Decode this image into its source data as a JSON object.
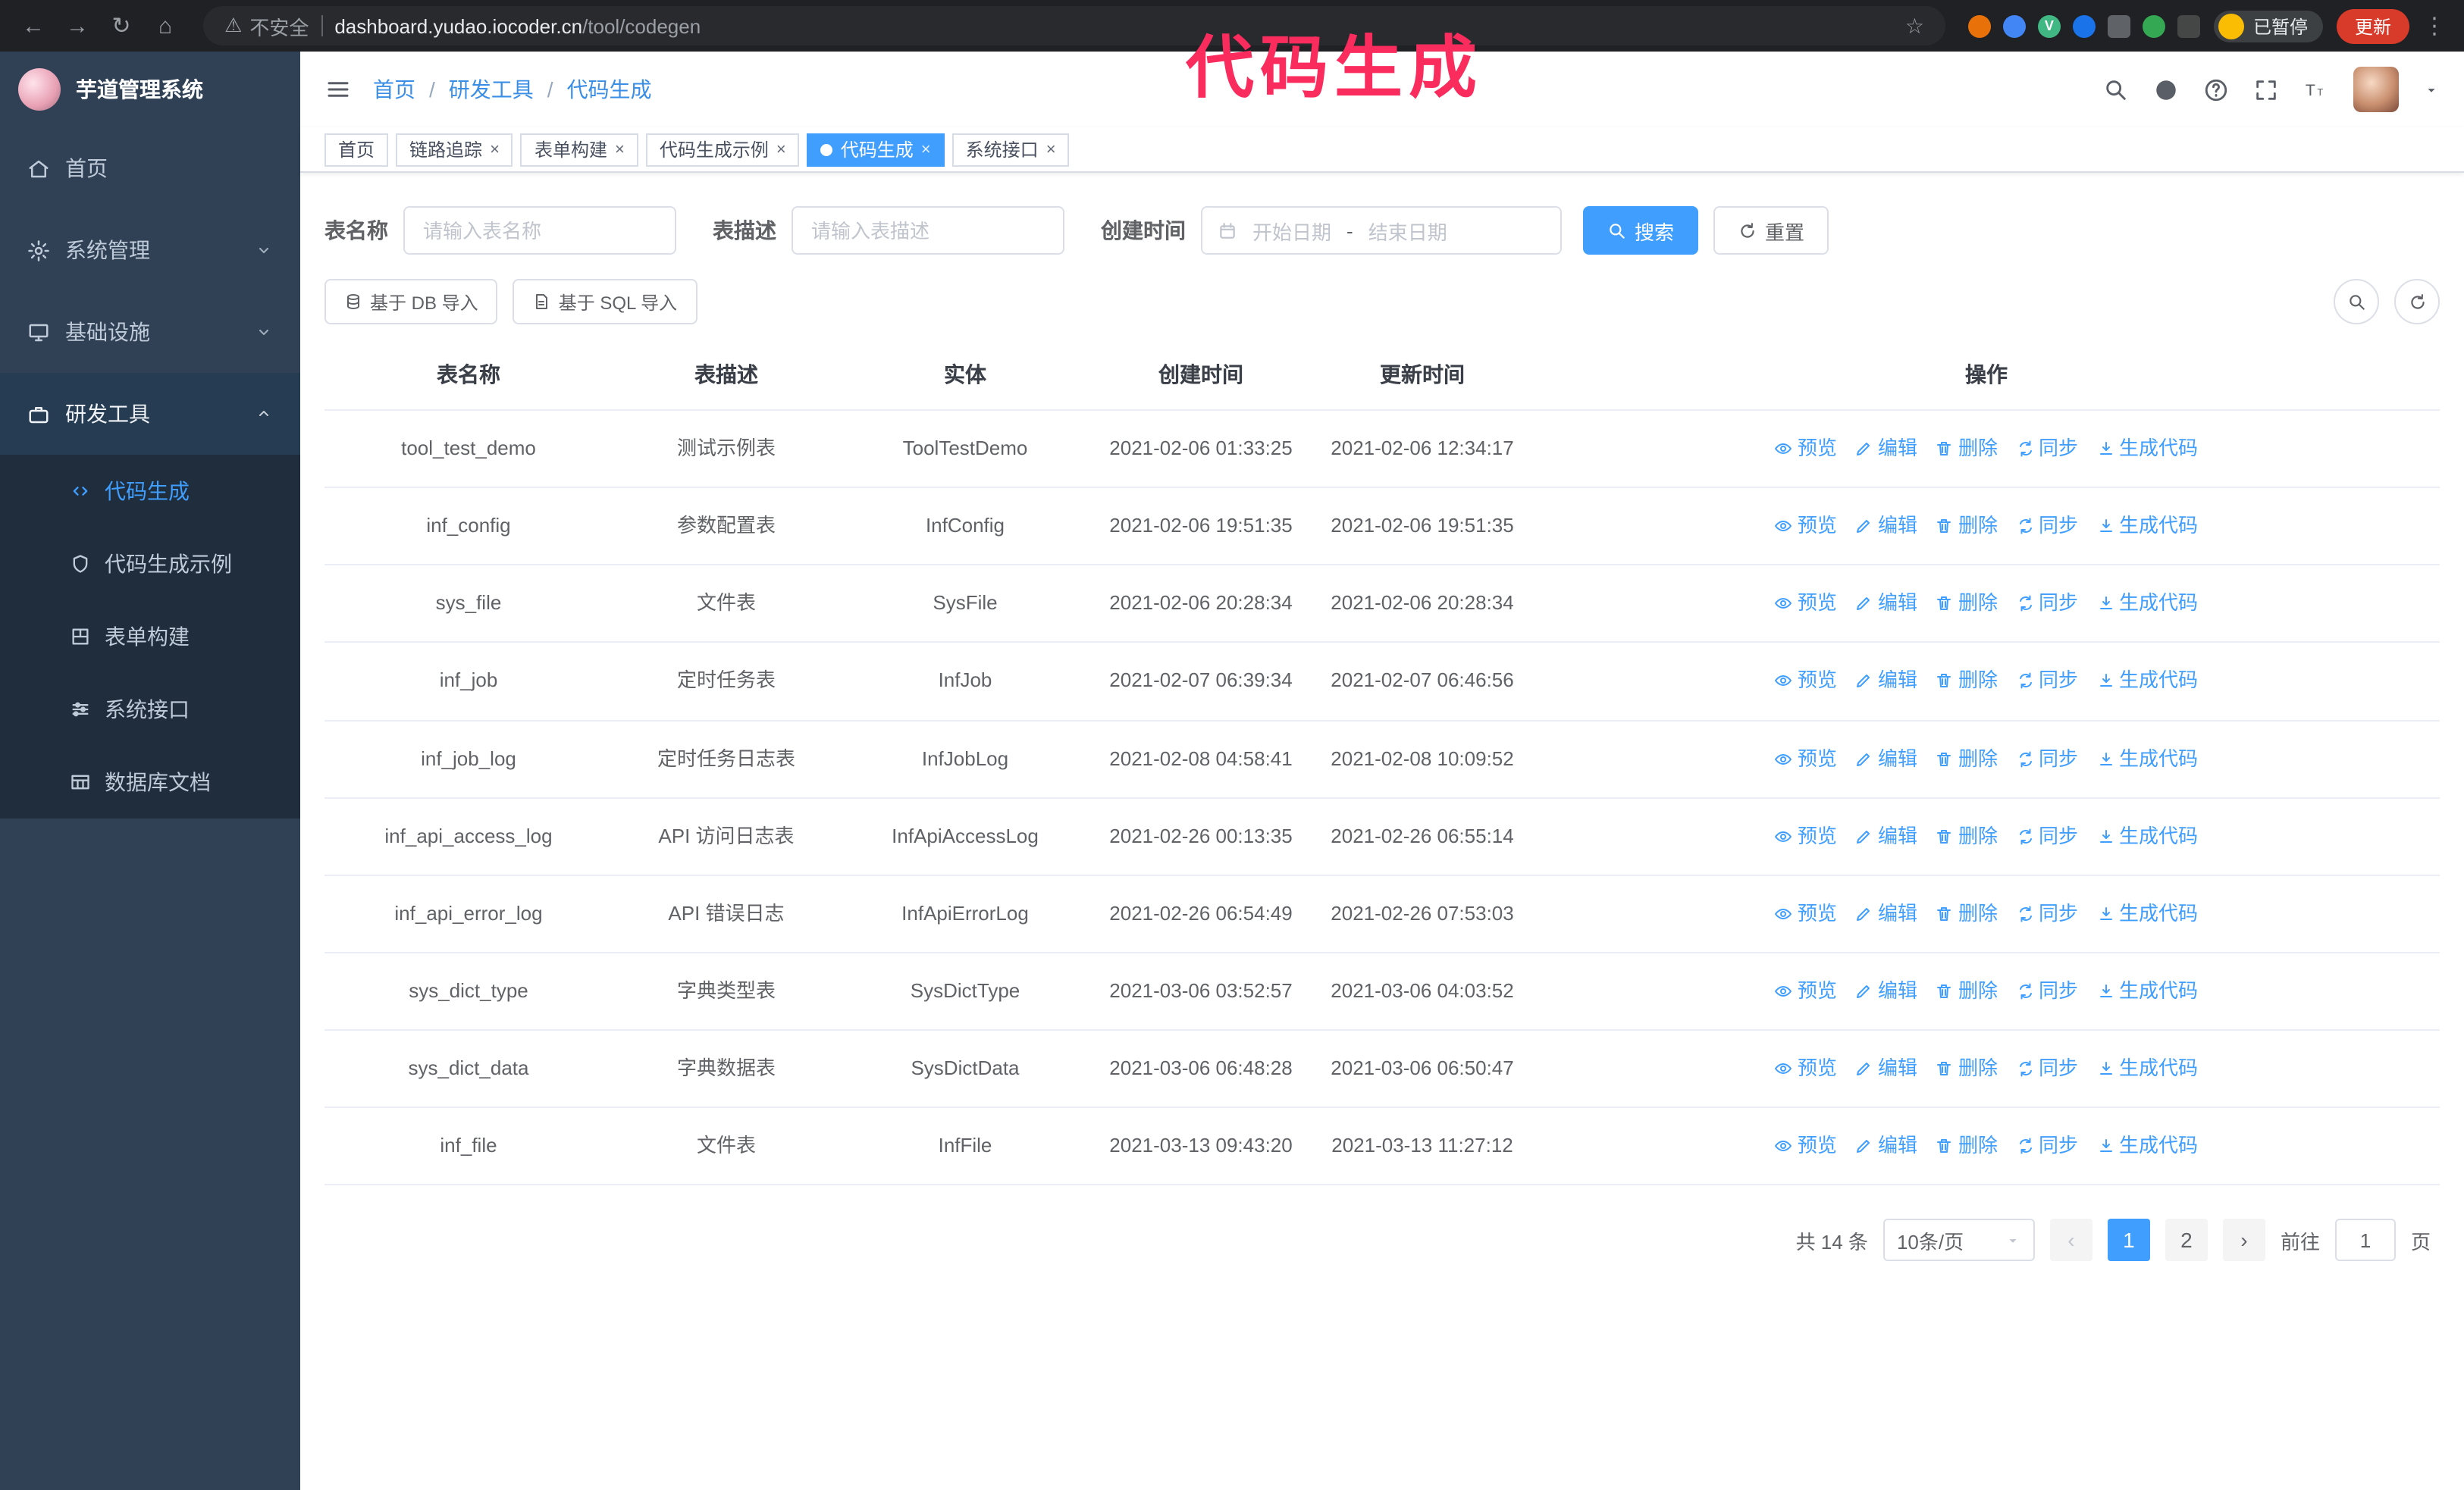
{
  "colors": {
    "accent": "#409eff",
    "sidebar_bg": "#304156",
    "submenu_bg": "#1f2d3d",
    "annotation": "#fa2c5e",
    "update_button_bg": "#d93b2b",
    "tag_active_bg": "#409eff"
  },
  "icons": {
    "search": "magnifier",
    "refresh": "circular-arrow",
    "calendar": "calendar",
    "eye": "eye",
    "edit": "pencil",
    "trash": "trash-can",
    "sync": "sync-arrows",
    "download": "down-arrow-tray",
    "github": "filled-circle",
    "question": "question-circle",
    "fullscreen": "corner-brackets",
    "font-size": "double-T",
    "db": "database-cylinder",
    "doc": "document"
  },
  "annotation": {
    "text": "代码生成"
  },
  "browser": {
    "security_text": "不安全",
    "url_domain": "dashboard.yudao.iocoder.cn",
    "url_path": "/tool/codegen",
    "profile_chip": "已暂停",
    "update_button": "更新"
  },
  "sidebar": {
    "logo_title": "芋道管理系统",
    "menu": [
      {
        "label": "首页"
      },
      {
        "label": "系统管理"
      },
      {
        "label": "基础设施"
      },
      {
        "label": "研发工具"
      }
    ],
    "submenu": [
      {
        "label": "代码生成"
      },
      {
        "label": "代码生成示例"
      },
      {
        "label": "表单构建"
      },
      {
        "label": "系统接口"
      },
      {
        "label": "数据库文档"
      }
    ]
  },
  "breadcrumb": {
    "items": [
      "首页",
      "研发工具",
      "代码生成"
    ],
    "separator": "/"
  },
  "tags": [
    {
      "label": "首页"
    },
    {
      "label": "链路追踪"
    },
    {
      "label": "表单构建"
    },
    {
      "label": "代码生成示例"
    },
    {
      "label": "代码生成"
    },
    {
      "label": "系统接口"
    }
  ],
  "filters": {
    "table_name_label": "表名称",
    "table_name_placeholder": "请输入表名称",
    "table_desc_label": "表描述",
    "table_desc_placeholder": "请输入表描述",
    "create_time_label": "创建时间",
    "date_start_placeholder": "开始日期",
    "date_separator": "-",
    "date_end_placeholder": "结束日期",
    "search_button": "搜索",
    "reset_button": "重置"
  },
  "toolbar": {
    "import_db_button": "基于 DB 导入",
    "import_sql_button": "基于 SQL 导入"
  },
  "table": {
    "columns": [
      "表名称",
      "表描述",
      "实体",
      "创建时间",
      "更新时间",
      "操作"
    ],
    "actions": [
      "预览",
      "编辑",
      "删除",
      "同步",
      "生成代码"
    ],
    "rows": [
      {
        "name": "tool_test_demo",
        "desc": "测试示例表",
        "entity": "ToolTestDemo",
        "create_time": "2021-02-06 01:33:25",
        "update_time": "2021-02-06 12:34:17"
      },
      {
        "name": "inf_config",
        "desc": "参数配置表",
        "entity": "InfConfig",
        "create_time": "2021-02-06 19:51:35",
        "update_time": "2021-02-06 19:51:35"
      },
      {
        "name": "sys_file",
        "desc": "文件表",
        "entity": "SysFile",
        "create_time": "2021-02-06 20:28:34",
        "update_time": "2021-02-06 20:28:34"
      },
      {
        "name": "inf_job",
        "desc": "定时任务表",
        "entity": "InfJob",
        "create_time": "2021-02-07 06:39:34",
        "update_time": "2021-02-07 06:46:56"
      },
      {
        "name": "inf_job_log",
        "desc": "定时任务日志表",
        "entity": "InfJobLog",
        "create_time": "2021-02-08 04:58:41",
        "update_time": "2021-02-08 10:09:52"
      },
      {
        "name": "inf_api_access_log",
        "desc": "API 访问日志表",
        "entity": "InfApiAccessLog",
        "create_time": "2021-02-26 00:13:35",
        "update_time": "2021-02-26 06:55:14"
      },
      {
        "name": "inf_api_error_log",
        "desc": "API 错误日志",
        "entity": "InfApiErrorLog",
        "create_time": "2021-02-26 06:54:49",
        "update_time": "2021-02-26 07:53:03"
      },
      {
        "name": "sys_dict_type",
        "desc": "字典类型表",
        "entity": "SysDictType",
        "create_time": "2021-03-06 03:52:57",
        "update_time": "2021-03-06 04:03:52"
      },
      {
        "name": "sys_dict_data",
        "desc": "字典数据表",
        "entity": "SysDictData",
        "create_time": "2021-03-06 06:48:28",
        "update_time": "2021-03-06 06:50:47"
      },
      {
        "name": "inf_file",
        "desc": "文件表",
        "entity": "InfFile",
        "create_time": "2021-03-13 09:43:20",
        "update_time": "2021-03-13 11:27:12"
      }
    ]
  },
  "pagination": {
    "total": "共 14 条",
    "page_size": "10条/页",
    "prev": "‹",
    "next": "›",
    "pages": [
      "1",
      "2"
    ],
    "goto_label": "前往",
    "goto_value": "1",
    "goto_suffix": "页"
  }
}
